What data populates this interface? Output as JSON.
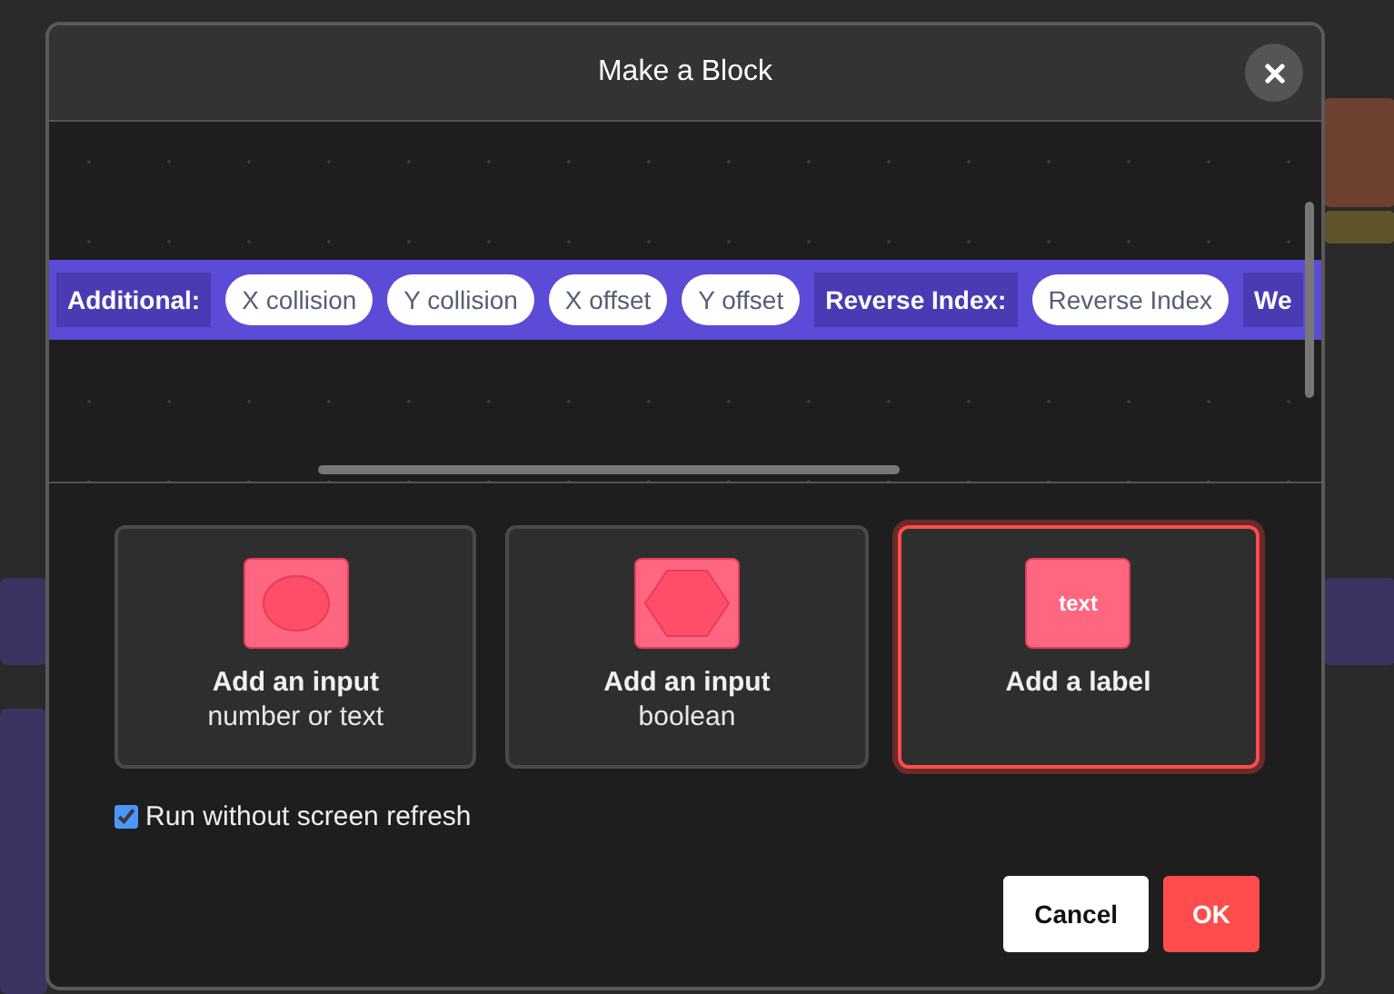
{
  "dialog": {
    "title": "Make a Block",
    "preview_block": [
      {
        "kind": "label",
        "text": "Additional:"
      },
      {
        "kind": "input",
        "text": "X collision"
      },
      {
        "kind": "input",
        "text": "Y collision"
      },
      {
        "kind": "input",
        "text": "X offset"
      },
      {
        "kind": "input",
        "text": "Y offset"
      },
      {
        "kind": "label",
        "text": "Reverse Index:"
      },
      {
        "kind": "input",
        "text": "Reverse Index"
      },
      {
        "kind": "label",
        "text": "We"
      }
    ],
    "options": [
      {
        "kind": "round",
        "title": "Add an input",
        "subtitle": "number or text",
        "selected": false
      },
      {
        "kind": "hexagon",
        "title": "Add an input",
        "subtitle": "boolean",
        "selected": false
      },
      {
        "kind": "text",
        "icon_text": "text",
        "title": "Add a label",
        "selected": true
      }
    ],
    "run_without_refresh": {
      "label": "Run without screen refresh",
      "checked": true
    },
    "buttons": [
      {
        "kind": "secondary",
        "label": "Cancel"
      },
      {
        "kind": "primary",
        "label": "OK"
      }
    ]
  }
}
